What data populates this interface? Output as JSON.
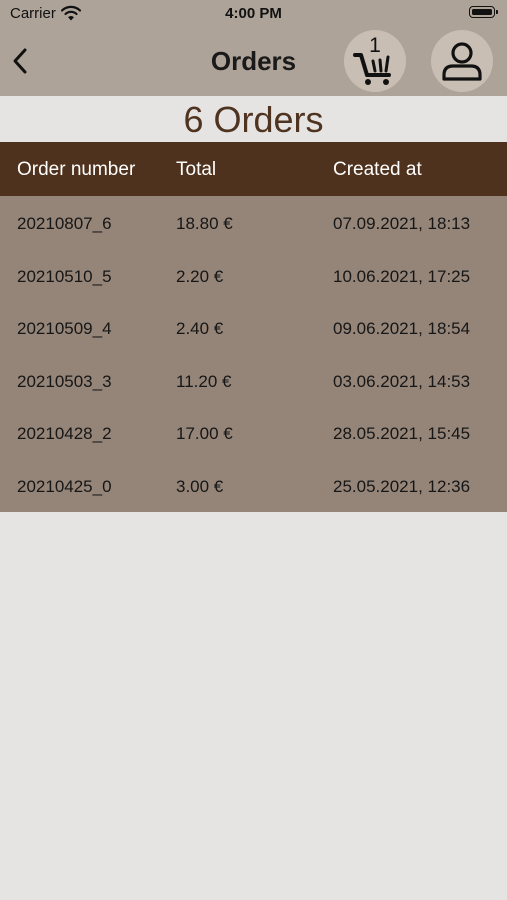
{
  "status_bar": {
    "carrier": "Carrier",
    "time": "4:00 PM"
  },
  "nav": {
    "title": "Orders",
    "cart_count": "1",
    "icons": [
      "back-chevron-icon",
      "cart-icon",
      "user-icon",
      "wifi-icon",
      "battery-icon"
    ]
  },
  "orders": {
    "heading": "6 Orders",
    "columns": [
      "Order number",
      "Total",
      "Created at"
    ],
    "rows": [
      {
        "number": "20210807_6",
        "total": "18.80 €",
        "created": "07.09.2021, 18:13"
      },
      {
        "number": "20210510_5",
        "total": "2.20 €",
        "created": "10.06.2021, 17:25"
      },
      {
        "number": "20210509_4",
        "total": "2.40 €",
        "created": "09.06.2021, 18:54"
      },
      {
        "number": "20210503_3",
        "total": "11.20 €",
        "created": "03.06.2021, 14:53"
      },
      {
        "number": "20210428_2",
        "total": "17.00 €",
        "created": "28.05.2021, 15:45"
      },
      {
        "number": "20210425_0",
        "total": "3.00 €",
        "created": "25.05.2021, 12:36"
      }
    ]
  },
  "colors": {
    "nav_background": "#aea399",
    "header_background": "#4f321d",
    "table_background": "#958579",
    "heading_text": "#4e3320",
    "page_background": "#e6e4e2"
  }
}
